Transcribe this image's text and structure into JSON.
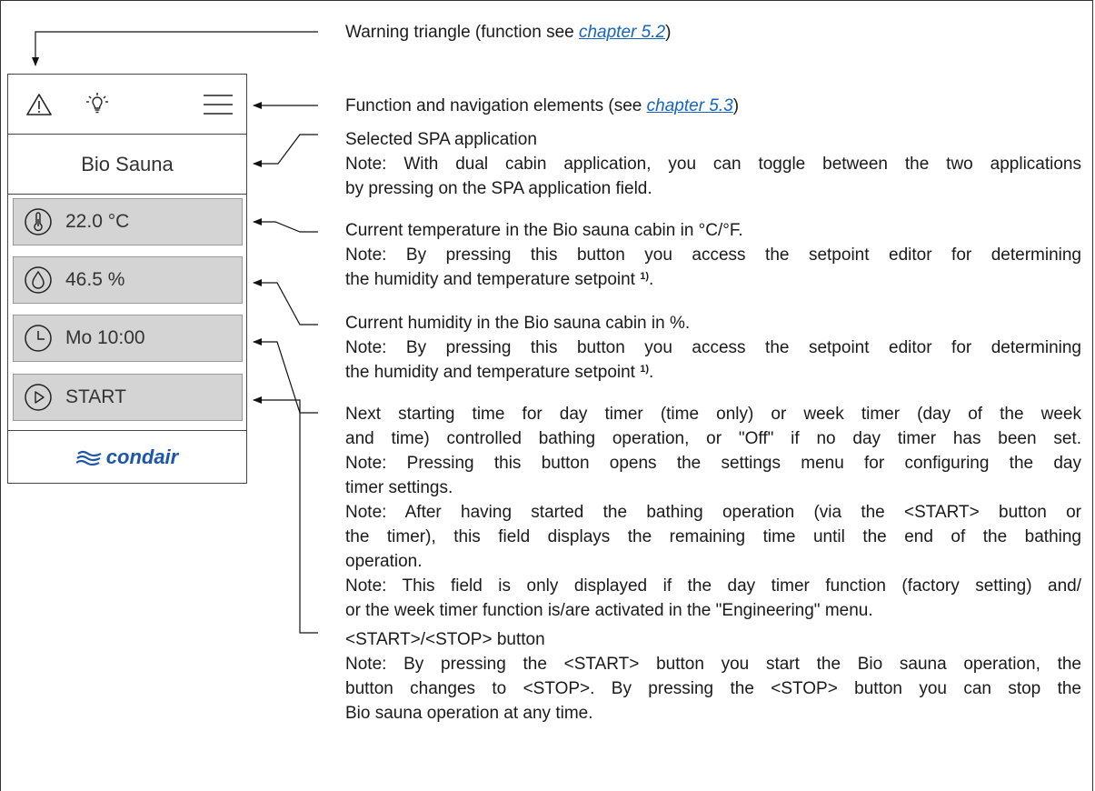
{
  "device": {
    "app_name": "Bio Sauna",
    "temperature": "22.0 °C",
    "humidity": "46.5 %",
    "timer": "Mo 10:00",
    "start_label": "START",
    "logo_text": "condair",
    "icons": {
      "warning": "warning-triangle-icon",
      "light": "light-bulb-icon",
      "menu": "hamburger-menu-icon",
      "thermometer": "thermometer-icon",
      "humidity": "water-drop-icon",
      "clock": "clock-icon",
      "play": "play-icon"
    },
    "colors": {
      "button_bg": "#d4d4d4",
      "brand": "#1d56a8",
      "link": "#1565c0"
    }
  },
  "descriptions": {
    "warning": {
      "pre": "Warning triangle (function see ",
      "link": "chapter 5.2",
      "post": ")"
    },
    "navigation": {
      "pre": "Function and navigation elements (see ",
      "link": "chapter 5.3",
      "post": ")"
    },
    "application": {
      "l1": "Selected SPA application",
      "l2": "Note: With dual cabin application, you can toggle between the two applications",
      "l3": "by pressing on the SPA application field."
    },
    "temperature": {
      "l1": "Current temperature in the Bio sauna cabin in °C/°F.",
      "l2": "Note: By pressing this button you access the setpoint editor for determining",
      "l3": "the humidity and temperature setpoint",
      "fn": "1)",
      "l3_end": "."
    },
    "humidity": {
      "l1": "Current humidity in the Bio sauna cabin in %.",
      "l2": "Note: By pressing this button you access the setpoint editor for determining",
      "l3": "the humidity and temperature setpoint",
      "fn": "1)",
      "l3_end": "."
    },
    "timer": {
      "l1": "Next starting time for day timer (time only) or week timer (day of the week",
      "l2": "and time) controlled bathing operation, or \"Off\" if no day timer has been set.",
      "l3": "Note: Pressing this button opens the settings menu for configuring the day",
      "l4": "timer settings.",
      "l5": "Note: After having started the bathing operation (via the <START> button or",
      "l6": "the timer), this field displays the remaining time until the end of the bathing",
      "l7": "operation.",
      "l8": "Note: This field is only displayed if the day timer function (factory setting) and/",
      "l9": "or the week timer function is/are activated in the \"Engineering\" menu."
    },
    "start": {
      "l1": "<START>/<STOP> button",
      "l2": "Note: By pressing the <START> button you start the Bio sauna operation, the",
      "l3": "button changes to <STOP>. By pressing the <STOP> button you can stop the",
      "l4": "Bio sauna operation at any time."
    }
  }
}
